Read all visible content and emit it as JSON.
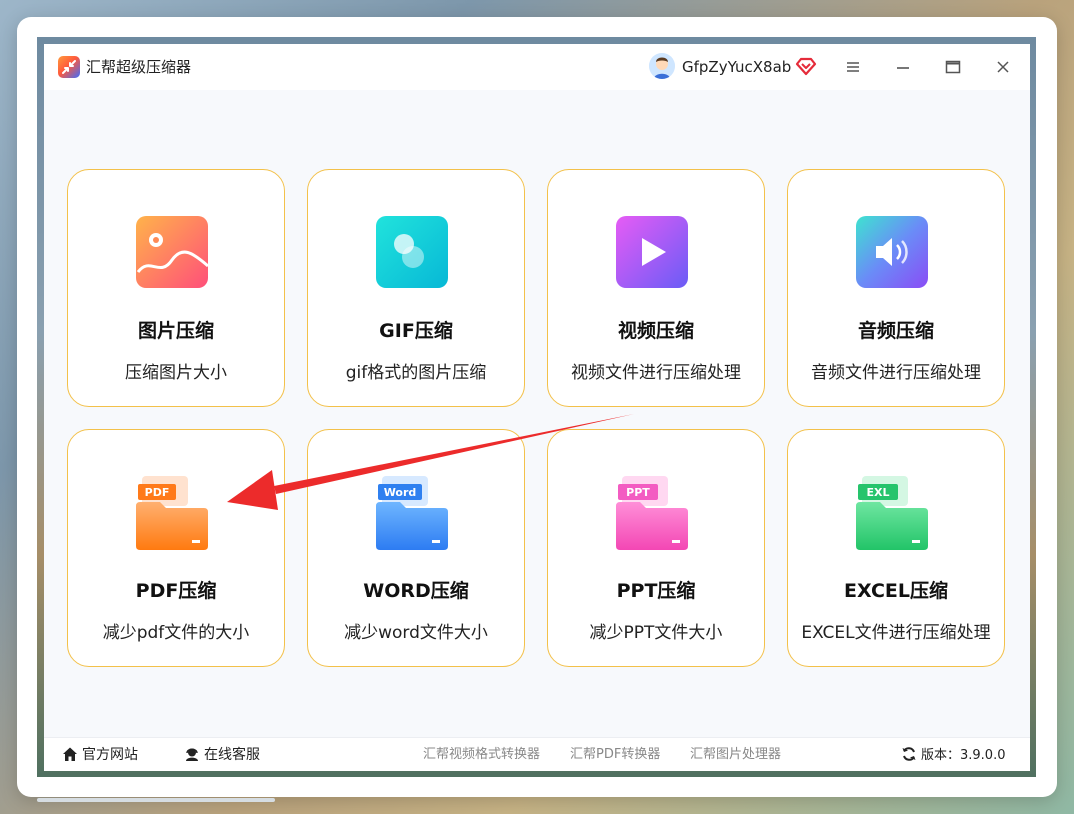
{
  "app": {
    "title": "汇帮超级压缩器"
  },
  "user": {
    "name": "GfpZyYucX8ab"
  },
  "cards": [
    {
      "title": "图片压缩",
      "desc": "压缩图片大小",
      "icon": "image-icon"
    },
    {
      "title": "GIF压缩",
      "desc": "gif格式的图片压缩",
      "icon": "gif-icon"
    },
    {
      "title": "视频压缩",
      "desc": "视频文件进行压缩处理",
      "icon": "video-play-icon"
    },
    {
      "title": "音频压缩",
      "desc": "音频文件进行压缩处理",
      "icon": "speaker-icon"
    },
    {
      "title": "PDF压缩",
      "desc": "减少pdf文件的大小",
      "icon": "pdf-folder-icon",
      "tag": "PDF"
    },
    {
      "title": "WORD压缩",
      "desc": "减少word文件大小",
      "icon": "word-folder-icon",
      "tag": "Word"
    },
    {
      "title": "PPT压缩",
      "desc": "减少PPT文件大小",
      "icon": "ppt-folder-icon",
      "tag": "PPT"
    },
    {
      "title": "EXCEL压缩",
      "desc": "EXCEL文件进行压缩处理",
      "icon": "excel-folder-icon",
      "tag": "EXL"
    }
  ],
  "footer": {
    "website": "官方网站",
    "support": "在线客服",
    "links": [
      "汇帮视频格式转换器",
      "汇帮PDF转换器",
      "汇帮图片处理器"
    ],
    "version_label": "版本：3.9.0.0"
  },
  "colors": {
    "card_border": "#f3c14a",
    "annotation_arrow": "#ec2b2b"
  }
}
